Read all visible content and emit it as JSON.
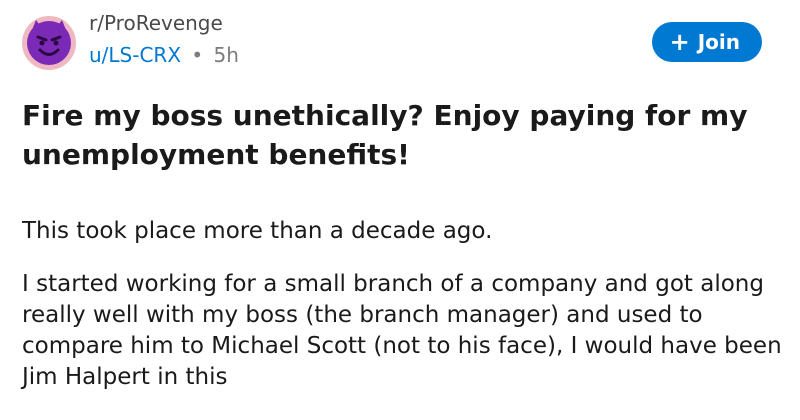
{
  "post": {
    "subreddit": "r/ProRevenge",
    "author": "u/LS-CRX",
    "separator": "•",
    "age": "5h",
    "title": "Fire my boss unethically? Enjoy paying for my unemployment benefits!",
    "body": [
      "This took place more than a decade ago.",
      "I started working for a small branch of a company and got along really well with my boss (the branch manager) and used to compare him to Michael Scott (not to his face), I would have been Jim Halpert in this"
    ]
  },
  "actions": {
    "join_label": "Join",
    "join_icon": "plus-icon"
  },
  "colors": {
    "accent": "#0079d3",
    "text": "#1a1a1b",
    "muted": "#7c7c7c",
    "avatar_bg": "#f0b8c0",
    "avatar_face": "#7b2ab8"
  },
  "icons": {
    "avatar": "devil-emoji-icon"
  }
}
